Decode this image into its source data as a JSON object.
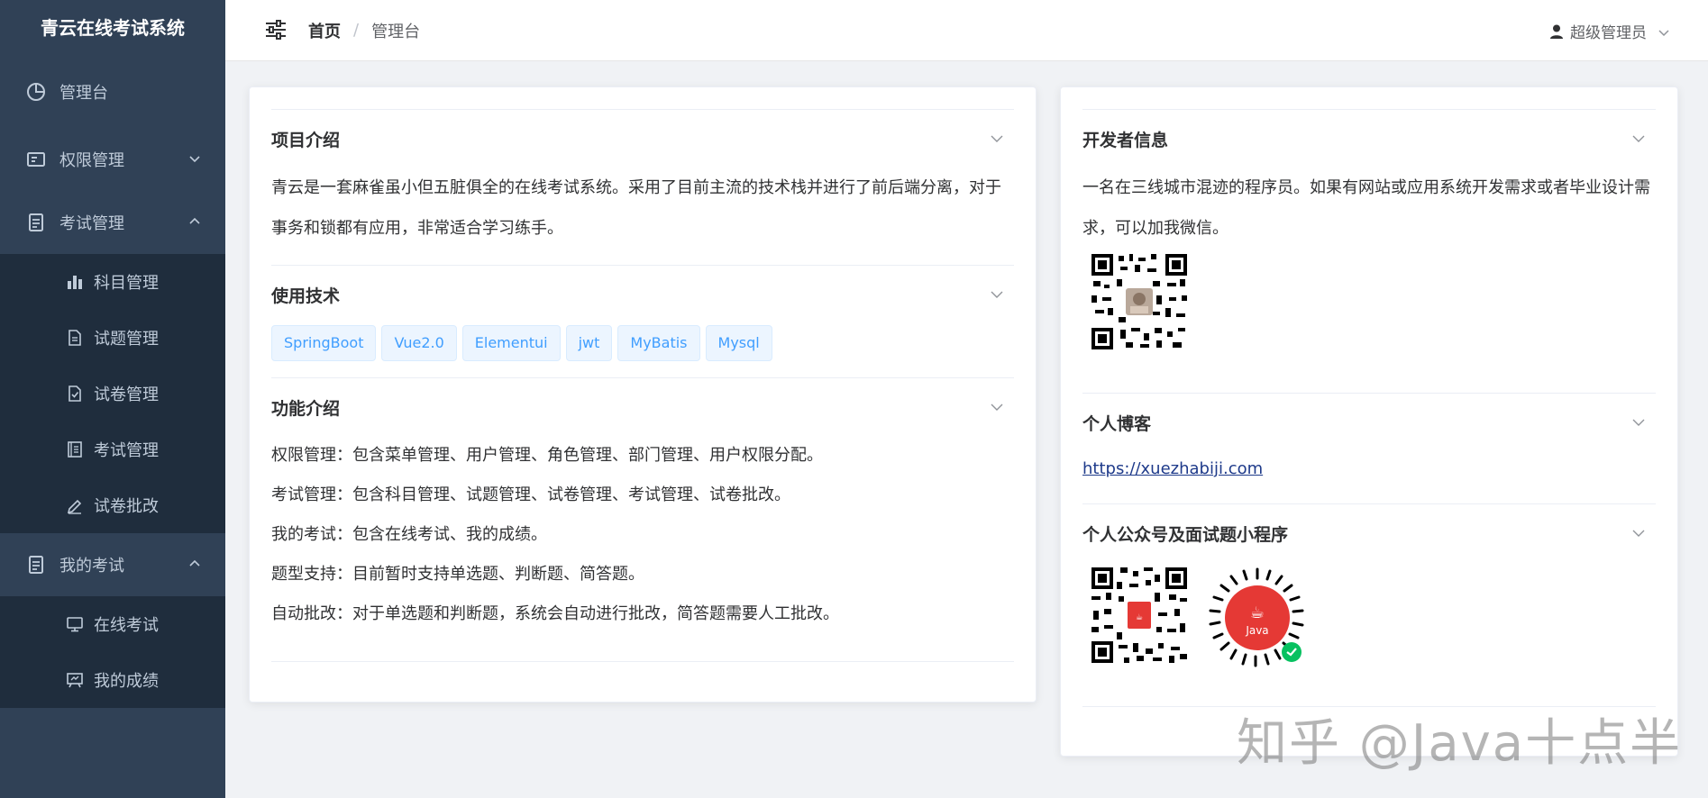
{
  "sidebar": {
    "logo": "青云在线考试系统",
    "items": [
      {
        "label": "管理台",
        "icon": "pie-chart-icon"
      },
      {
        "label": "权限管理",
        "icon": "id-card-icon",
        "expanded": false
      },
      {
        "label": "考试管理",
        "icon": "document-icon",
        "expanded": true,
        "children": [
          {
            "label": "科目管理",
            "icon": "bar-chart-icon"
          },
          {
            "label": "试题管理",
            "icon": "file-icon"
          },
          {
            "label": "试卷管理",
            "icon": "file-check-icon"
          },
          {
            "label": "考试管理",
            "icon": "notebook-icon"
          },
          {
            "label": "试卷批改",
            "icon": "edit-pen-icon"
          }
        ]
      },
      {
        "label": "我的考试",
        "icon": "document-icon",
        "expanded": true,
        "children": [
          {
            "label": "在线考试",
            "icon": "monitor-icon"
          },
          {
            "label": "我的成绩",
            "icon": "scoreboard-icon"
          }
        ]
      }
    ]
  },
  "header": {
    "breadcrumb_home": "首页",
    "breadcrumb_sep": "/",
    "breadcrumb_current": "管理台",
    "user_name": "超级管理员"
  },
  "left_card": {
    "intro": {
      "title": "项目介绍",
      "text": "青云是一套麻雀虽小但五脏俱全的在线考试系统。采用了目前主流的技术栈并进行了前后端分离，对于事务和锁都有应用，非常适合学习练手。"
    },
    "tech": {
      "title": "使用技术",
      "tags": [
        "SpringBoot",
        "Vue2.0",
        "Elementui",
        "jwt",
        "MyBatis",
        "Mysql"
      ]
    },
    "features": {
      "title": "功能介绍",
      "lines": [
        "权限管理：包含菜单管理、用户管理、角色管理、部门管理、用户权限分配。",
        "考试管理：包含科目管理、试题管理、试卷管理、考试管理、试卷批改。",
        "我的考试：包含在线考试、我的成绩。",
        "题型支持：目前暂时支持单选题、判断题、简答题。",
        "自动批改：对于单选题和判断题，系统会自动进行批改，简答题需要人工批改。"
      ]
    }
  },
  "right_card": {
    "developer": {
      "title": "开发者信息",
      "text": "一名在三线城市混迹的程序员。如果有网站或应用系统开发需求或者毕业设计需求，可以加我微信。"
    },
    "blog": {
      "title": "个人博客",
      "link": "https://xuezhabiji.com"
    },
    "wechat": {
      "title": "个人公众号及面试题小程序",
      "mini_label": "Java"
    }
  },
  "watermark": "知乎 @Java十点半",
  "colors": {
    "sidebar_bg": "#304156",
    "submenu_bg": "#1f2d3d",
    "accent": "#409eff",
    "tag_bg": "#ecf5ff"
  }
}
